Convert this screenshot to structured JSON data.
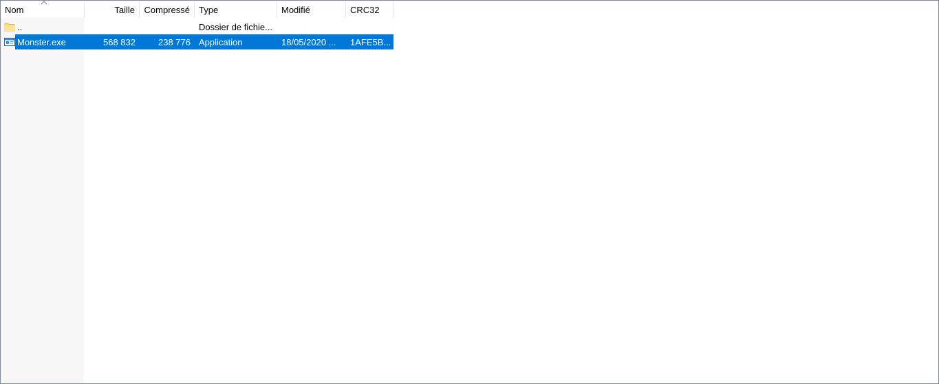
{
  "columns": {
    "name": "Nom",
    "size": "Taille",
    "compressed": "Compressé",
    "type": "Type",
    "modified": "Modifié",
    "crc": "CRC32"
  },
  "rows": [
    {
      "icon": "folder-icon",
      "name": "..",
      "size": "",
      "compressed": "",
      "type": "Dossier de fichie...",
      "modified": "",
      "crc": "",
      "selected": false
    },
    {
      "icon": "application-icon",
      "name": "Monster.exe",
      "size": "568 832",
      "compressed": "238 776",
      "type": "Application",
      "modified": "18/05/2020 ...",
      "crc": "1AFE5B...",
      "selected": true
    }
  ],
  "colors": {
    "selection": "#0078d7",
    "sorted_column": "#f7f7f7",
    "border": "#828790"
  }
}
